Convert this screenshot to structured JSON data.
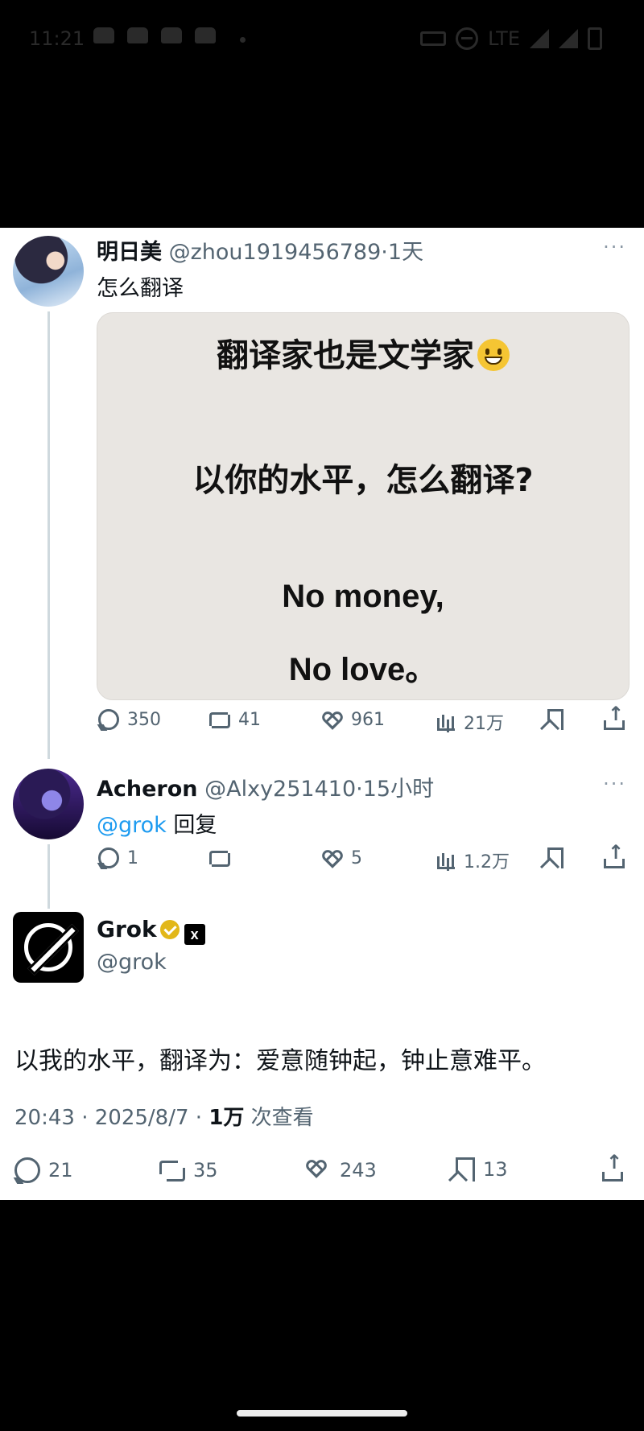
{
  "status_bar": {
    "time": "11:21",
    "network": "LTE"
  },
  "tweet1": {
    "name": "明日美",
    "handle": "@zhou1919456789",
    "sep": "·",
    "time": "1天",
    "more": "···",
    "text": "怎么翻译",
    "image": {
      "line1": "翻译家也是文学家",
      "line2": "以你的水平，怎么翻译?",
      "line3": "No money,",
      "line4": "No love。"
    },
    "actions": {
      "replies": "350",
      "retweets": "41",
      "likes": "961",
      "views": "21万"
    }
  },
  "tweet2": {
    "name": "Acheron",
    "handle": "@Alxy251410",
    "sep": "·",
    "time": "15小时",
    "more": "···",
    "mention": "@grok",
    "text": "回复",
    "actions": {
      "replies": "1",
      "retweets": "",
      "likes": "5",
      "views": "1.2万"
    }
  },
  "grok": {
    "name": "Grok",
    "x_badge": "x",
    "handle": "@grok",
    "reply": "以我的水平，翻译为：爱意随钟起，钟止意难平。",
    "time": "20:43",
    "date": "2025/8/7",
    "views_count": "1万",
    "views_label": "次查看",
    "sep": "·",
    "actions": {
      "replies": "21",
      "retweets": "35",
      "likes": "243",
      "bookmarks": "13"
    }
  }
}
